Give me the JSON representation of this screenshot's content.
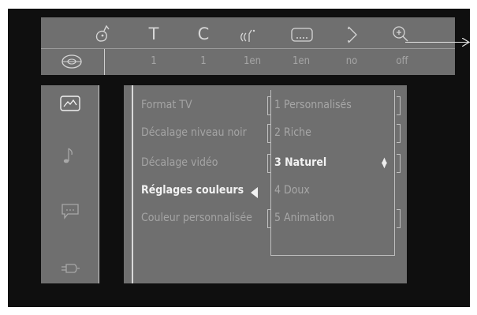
{
  "top_bar": {
    "icons": [
      "audio-icon",
      "title-icon",
      "chapter-icon",
      "sound-mode-icon",
      "subtitle-icon",
      "angle-icon",
      "zoom-icon"
    ],
    "title_glyph": "T",
    "chapter_glyph": "C",
    "disc_icon": "disc-icon",
    "values": [
      "1",
      "1",
      "1en",
      "1en",
      "no",
      "off"
    ]
  },
  "side_menu": {
    "items": [
      "picture-icon",
      "music-note-icon",
      "subtitle-bubble-icon",
      "plug-icon"
    ]
  },
  "settings": {
    "labels": [
      "Format TV",
      "Décalage niveau noir",
      "Décalage vidéo",
      "Réglages couleurs",
      "Couleur personnalisée"
    ]
  },
  "options": {
    "items": [
      "1 Personnalisés",
      "2 Riche",
      "3 Naturel",
      "4 Doux",
      "5 Animation"
    ]
  },
  "colors": {
    "background": "#0f0f0f",
    "panel": "#6f6f6f",
    "text_dim": "#a4a4a4",
    "text_active": "#f2f2f2"
  }
}
